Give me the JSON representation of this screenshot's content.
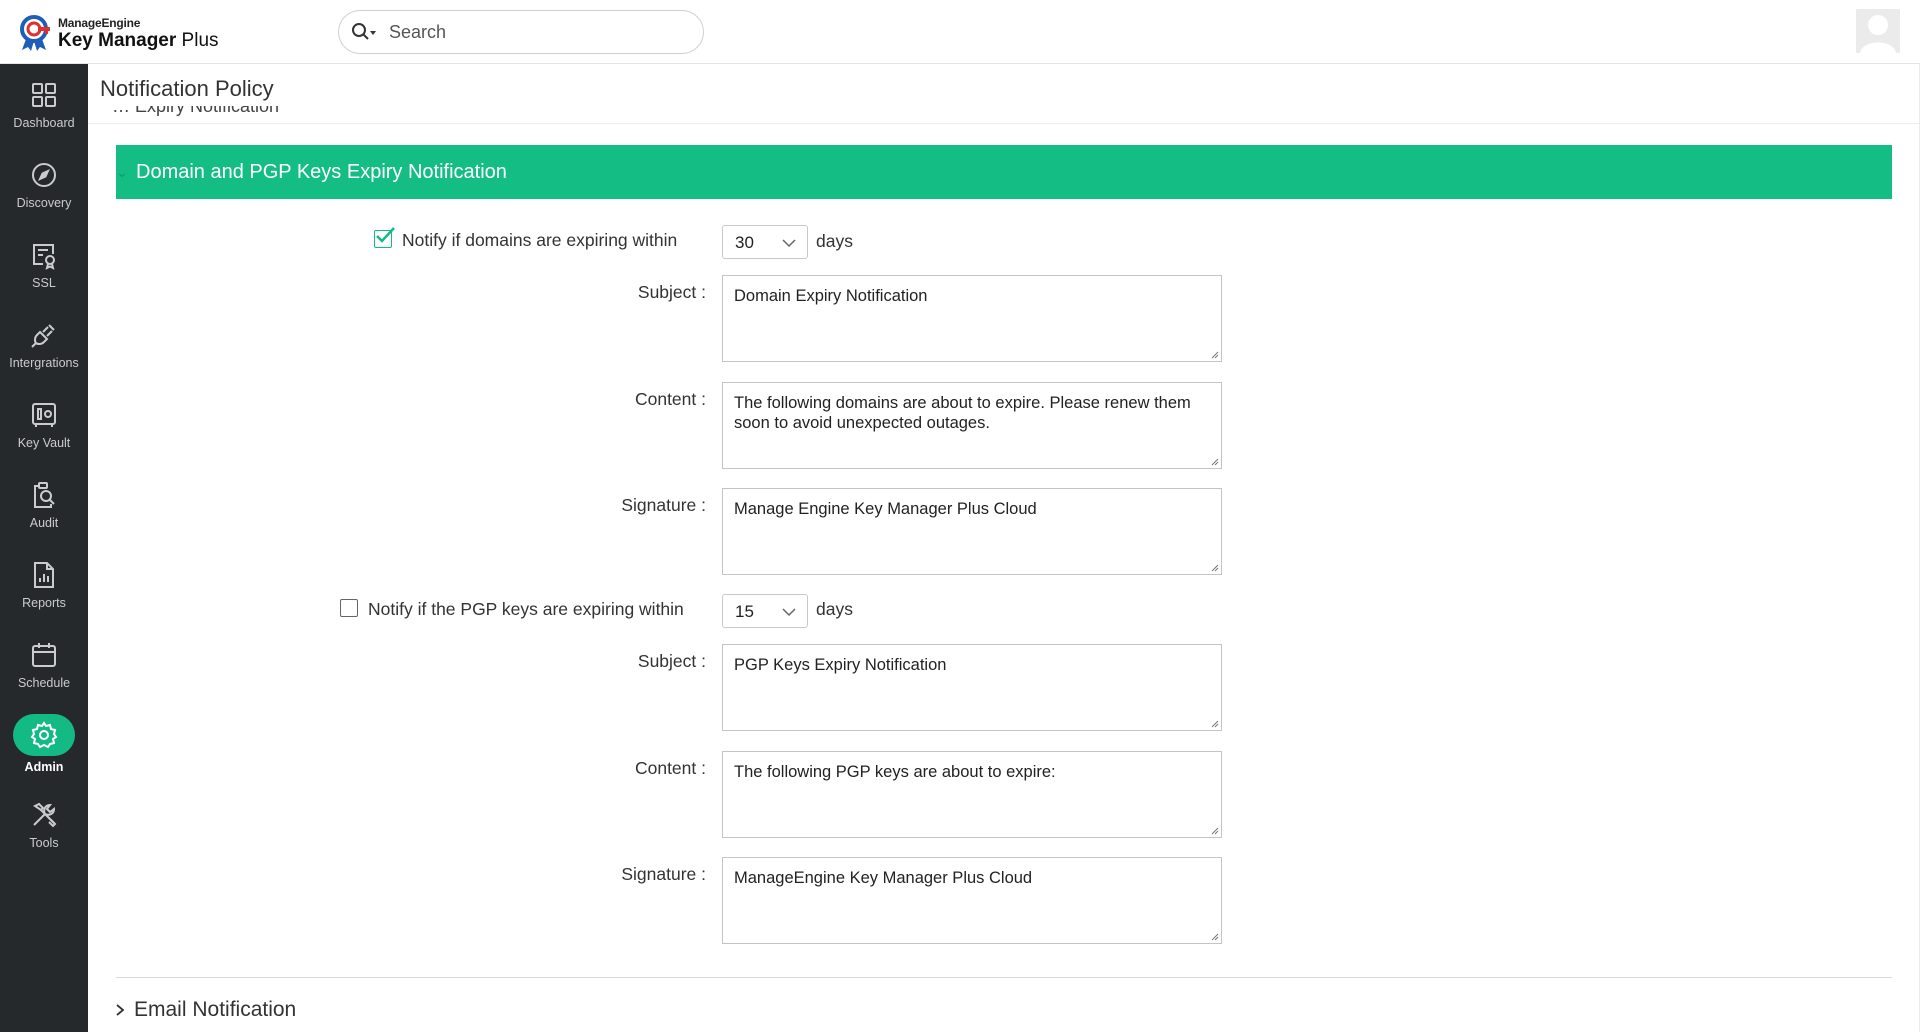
{
  "app": {
    "brand": "ManageEngine",
    "product_bold": "Key Manager",
    "product_light": " Plus"
  },
  "search": {
    "placeholder": "Search"
  },
  "sidebar": {
    "items": [
      {
        "label": "Dashboard",
        "icon": "dashboard-icon"
      },
      {
        "label": "Discovery",
        "icon": "compass-icon"
      },
      {
        "label": "SSL",
        "icon": "certificate-icon"
      },
      {
        "label": "Intergrations",
        "icon": "plug-icon"
      },
      {
        "label": "Key Vault",
        "icon": "vault-icon"
      },
      {
        "label": "Audit",
        "icon": "audit-icon"
      },
      {
        "label": "Reports",
        "icon": "report-icon"
      },
      {
        "label": "Schedule",
        "icon": "calendar-icon"
      },
      {
        "label": "Admin",
        "icon": "gear-icon",
        "active": true
      },
      {
        "label": "Tools",
        "icon": "tools-icon"
      }
    ]
  },
  "page": {
    "title": "Notification Policy",
    "clipped_previous_section": "… Expiry Notification"
  },
  "section": {
    "title": "Domain and PGP Keys Expiry Notification",
    "accent_color": "#13bd84",
    "domains": {
      "checkbox_label": "Notify if domains are expiring within",
      "checked": true,
      "days_value": "30",
      "days_unit": "days",
      "subject_label": "Subject :",
      "subject": "Domain Expiry Notification",
      "content_label": "Content :",
      "content": "The following domains are about to expire. Please renew them soon to avoid unexpected outages.",
      "signature_label": "Signature :",
      "signature": "Manage Engine Key Manager Plus Cloud"
    },
    "pgp": {
      "checkbox_label": "Notify if the PGP keys are expiring within",
      "checked": false,
      "days_value": "15",
      "days_unit": "days",
      "subject_label": "Subject :",
      "subject": "PGP Keys Expiry Notification",
      "content_label": "Content :",
      "content": "The following PGP keys are about to expire:",
      "signature_label": "Signature :",
      "signature": "ManageEngine Key Manager Plus Cloud"
    }
  },
  "next_section": {
    "title": "Email Notification"
  }
}
